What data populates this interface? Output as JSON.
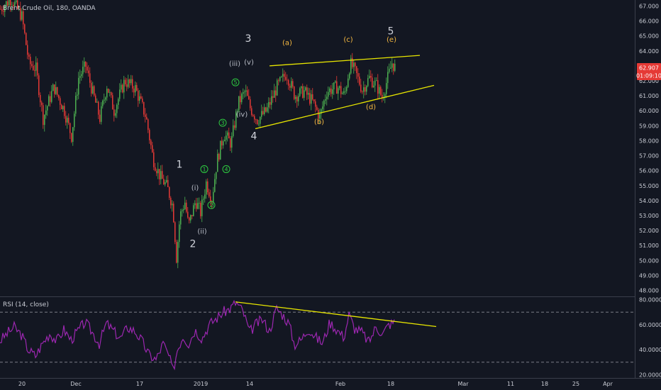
{
  "header": {
    "symbol": "Brent Crude Oil, 180, OANDA"
  },
  "rsi_header": "RSI (14, close)",
  "price_badge": {
    "price": "62.907",
    "timer": "01:09:10",
    "color": "#e53935"
  },
  "colors": {
    "up": "#4caf50",
    "down": "#e53935",
    "rsi": "#9c27b0",
    "trend": "#e8e600",
    "wave_white": "#d1d4dc",
    "wave_orange": "#f5b841",
    "wave_green": "#2ecc40",
    "background": "#131722"
  },
  "chart_data": {
    "type": "candlestick",
    "price_axis": {
      "ticks": [
        "67.000",
        "66.000",
        "65.000",
        "64.000",
        "63.000",
        "62.000",
        "61.000",
        "60.000",
        "59.000",
        "58.000",
        "57.000",
        "56.000",
        "55.000",
        "54.000",
        "53.000",
        "52.000",
        "51.000",
        "50.000",
        "49.000",
        "48.000"
      ],
      "range": [
        47.6,
        67.4
      ]
    },
    "rsi_axis": {
      "ticks": [
        "80.0000",
        "60.0000",
        "40.0000",
        "20.0000"
      ],
      "range": [
        18,
        82
      ],
      "bands": [
        70,
        30
      ]
    },
    "time_axis": [
      "20",
      "Dec",
      "17",
      "2019",
      "14",
      "Feb",
      "18",
      "Mar",
      "11",
      "18",
      "25",
      "Apr"
    ],
    "price_path": [
      [
        0,
        66.8
      ],
      [
        15,
        67.5
      ],
      [
        30,
        66.3
      ],
      [
        40,
        63.2
      ],
      [
        50,
        62.8
      ],
      [
        60,
        59.5
      ],
      [
        75,
        61.6
      ],
      [
        90,
        60.0
      ],
      [
        100,
        58.3
      ],
      [
        110,
        62.2
      ],
      [
        120,
        63.0
      ],
      [
        130,
        61.2
      ],
      [
        140,
        59.5
      ],
      [
        150,
        61.7
      ],
      [
        160,
        60.0
      ],
      [
        175,
        62.0
      ],
      [
        190,
        61.5
      ],
      [
        205,
        59.6
      ],
      [
        215,
        56.8
      ],
      [
        225,
        55.6
      ],
      [
        235,
        54.9
      ],
      [
        243,
        53.6
      ],
      [
        248,
        50.2
      ],
      [
        253,
        53.0
      ],
      [
        260,
        53.9
      ],
      [
        265,
        52.3
      ],
      [
        275,
        54.0
      ],
      [
        282,
        53.2
      ],
      [
        290,
        55.2
      ],
      [
        298,
        54.1
      ],
      [
        305,
        56.6
      ],
      [
        315,
        58.5
      ],
      [
        325,
        57.8
      ],
      [
        335,
        60.5
      ],
      [
        345,
        61.3
      ],
      [
        352,
        60.2
      ],
      [
        362,
        59.4
      ],
      [
        375,
        60.0
      ],
      [
        390,
        61.6
      ],
      [
        403,
        62.5
      ],
      [
        415,
        61.0
      ],
      [
        428,
        61.3
      ],
      [
        440,
        60.6
      ],
      [
        450,
        59.6
      ],
      [
        460,
        61.3
      ],
      [
        475,
        61.6
      ],
      [
        485,
        61.0
      ],
      [
        493,
        63.2
      ],
      [
        500,
        62.6
      ],
      [
        510,
        61.4
      ],
      [
        520,
        62.2
      ],
      [
        530,
        61.7
      ],
      [
        538,
        60.9
      ],
      [
        546,
        62.2
      ],
      [
        552,
        63.2
      ],
      [
        556,
        62.9
      ]
    ],
    "rsi_path": [
      [
        0,
        47
      ],
      [
        10,
        53
      ],
      [
        20,
        58
      ],
      [
        30,
        52
      ],
      [
        40,
        40
      ],
      [
        50,
        35
      ],
      [
        60,
        45
      ],
      [
        70,
        53
      ],
      [
        80,
        47
      ],
      [
        90,
        56
      ],
      [
        100,
        48
      ],
      [
        110,
        55
      ],
      [
        120,
        62
      ],
      [
        130,
        54
      ],
      [
        140,
        45
      ],
      [
        150,
        61
      ],
      [
        160,
        55
      ],
      [
        170,
        49
      ],
      [
        180,
        58
      ],
      [
        190,
        55
      ],
      [
        200,
        47
      ],
      [
        210,
        36
      ],
      [
        220,
        32
      ],
      [
        230,
        45
      ],
      [
        238,
        35
      ],
      [
        244,
        23
      ],
      [
        250,
        40
      ],
      [
        258,
        51
      ],
      [
        266,
        45
      ],
      [
        275,
        56
      ],
      [
        285,
        49
      ],
      [
        295,
        60
      ],
      [
        305,
        65
      ],
      [
        315,
        70
      ],
      [
        325,
        73
      ],
      [
        333,
        78
      ],
      [
        343,
        70
      ],
      [
        352,
        54
      ],
      [
        360,
        60
      ],
      [
        370,
        64
      ],
      [
        380,
        55
      ],
      [
        390,
        73
      ],
      [
        400,
        67
      ],
      [
        408,
        60
      ],
      [
        415,
        44
      ],
      [
        425,
        48
      ],
      [
        435,
        57
      ],
      [
        445,
        50
      ],
      [
        455,
        45
      ],
      [
        465,
        62
      ],
      [
        475,
        56
      ],
      [
        485,
        50
      ],
      [
        492,
        68
      ],
      [
        500,
        57
      ],
      [
        510,
        54
      ],
      [
        520,
        46
      ],
      [
        530,
        58
      ],
      [
        540,
        53
      ],
      [
        548,
        60
      ],
      [
        556,
        62
      ]
    ],
    "trendlines": [
      {
        "from": [
          380,
          63.0
        ],
        "to": [
          592,
          63.7
        ]
      },
      {
        "from": [
          360,
          58.8
        ],
        "to": [
          612,
          61.7
        ]
      },
      {
        "from": [
          332,
          78.2
        ],
        "to": [
          615,
          58.5
        ],
        "pane": "rsi"
      }
    ],
    "wave_labels": [
      {
        "text": "1",
        "style": "white",
        "at": [
          253,
          56.2
        ]
      },
      {
        "text": "2",
        "style": "white",
        "at": [
          272,
          50.9
        ]
      },
      {
        "text": "3",
        "style": "white",
        "at": [
          350,
          64.6
        ]
      },
      {
        "text": "4",
        "style": "white",
        "at": [
          358,
          58.1
        ]
      },
      {
        "text": "5",
        "style": "white5",
        "at": [
          551,
          65.1
        ]
      },
      {
        "text": "(i)",
        "style": "gray",
        "at": [
          275,
          54.7
        ]
      },
      {
        "text": "(ii)",
        "style": "gray",
        "at": [
          285,
          51.8
        ]
      },
      {
        "text": "(iii)",
        "style": "gray",
        "at": [
          331,
          63.0
        ]
      },
      {
        "text": "(iv)",
        "style": "gray",
        "at": [
          341,
          59.6
        ]
      },
      {
        "text": "(v)",
        "style": "gray",
        "at": [
          351,
          63.1
        ]
      },
      {
        "text": "(a)",
        "style": "orange",
        "at": [
          405,
          64.4
        ]
      },
      {
        "text": "(b)",
        "style": "orange",
        "at": [
          450,
          59.1
        ]
      },
      {
        "text": "(c)",
        "style": "orange",
        "at": [
          491,
          64.6
        ]
      },
      {
        "text": "(d)",
        "style": "orange",
        "at": [
          523,
          60.1
        ]
      },
      {
        "text": "(e)",
        "style": "orange",
        "at": [
          552,
          64.6
        ]
      },
      {
        "text": "1",
        "style": "green",
        "at": [
          288,
          56.1
        ]
      },
      {
        "text": "2",
        "style": "green",
        "at": [
          298,
          53.7
        ]
      },
      {
        "text": "3",
        "style": "green",
        "at": [
          314,
          59.2
        ]
      },
      {
        "text": "4",
        "style": "green",
        "at": [
          319,
          56.1
        ]
      },
      {
        "text": "5",
        "style": "green",
        "at": [
          332,
          61.9
        ]
      }
    ]
  }
}
